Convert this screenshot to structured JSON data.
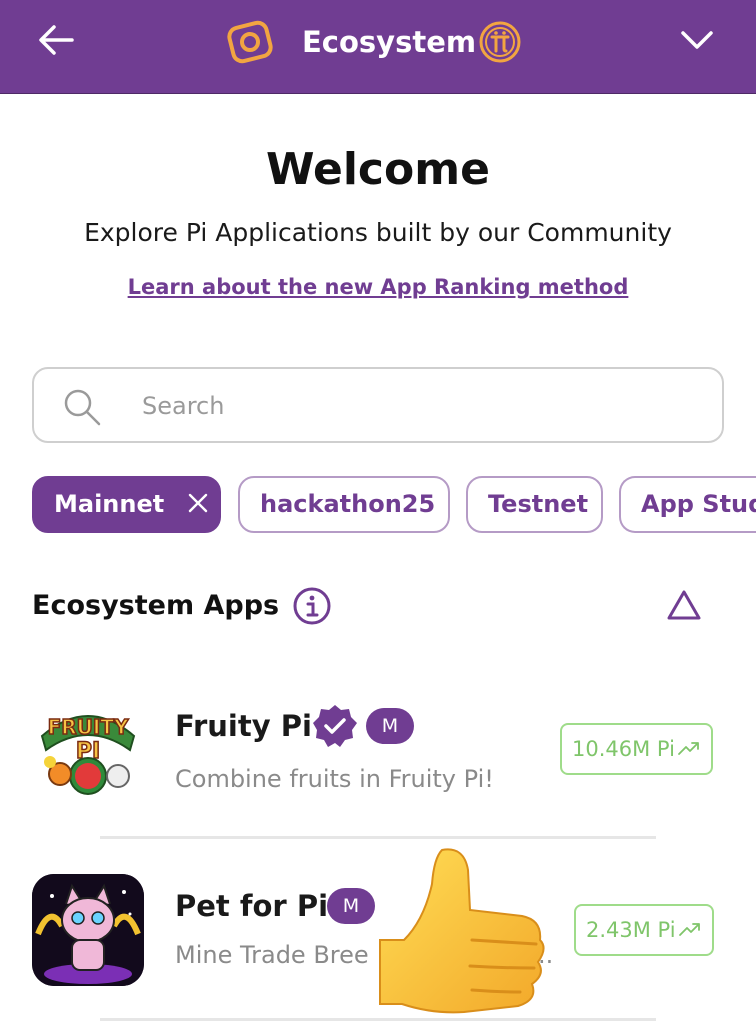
{
  "header": {
    "title": "Ecosystem",
    "accent_color": "#703d92",
    "icons": {
      "back": "arrow-left-icon",
      "brand": "pi-browser-icon",
      "coin": "pi-coin-icon",
      "menu": "chevron-down-icon"
    }
  },
  "welcome": {
    "title": "Welcome",
    "subtitle": "Explore Pi Applications built by our Community",
    "link": "Learn about the new App Ranking method"
  },
  "search": {
    "placeholder": "Search",
    "value": ""
  },
  "filters": [
    {
      "label": "Mainnet",
      "active": true
    },
    {
      "label": "hackathon25",
      "active": false
    },
    {
      "label": "Testnet",
      "active": false
    },
    {
      "label": "App Stud",
      "active": false
    }
  ],
  "section": {
    "title": "Ecosystem Apps"
  },
  "apps": [
    {
      "name": "Fruity Pi",
      "badge": "M",
      "verified": true,
      "description": "Combine fruits in Fruity Pi!",
      "volume": "10.46M Pi",
      "icon_text": "FRUITY PI"
    },
    {
      "name": "Pet for Pi",
      "badge": "M",
      "verified": false,
      "description": "Mine Trade Bree",
      "description_tail": "..",
      "volume": "2.43M Pi"
    }
  ],
  "overlay": {
    "emoji": "thumbs-up-icon"
  },
  "colors": {
    "purple": "#703d92",
    "green_border": "#9fdc8a",
    "green_text": "#7fc56a",
    "gold": "#f2a541"
  }
}
